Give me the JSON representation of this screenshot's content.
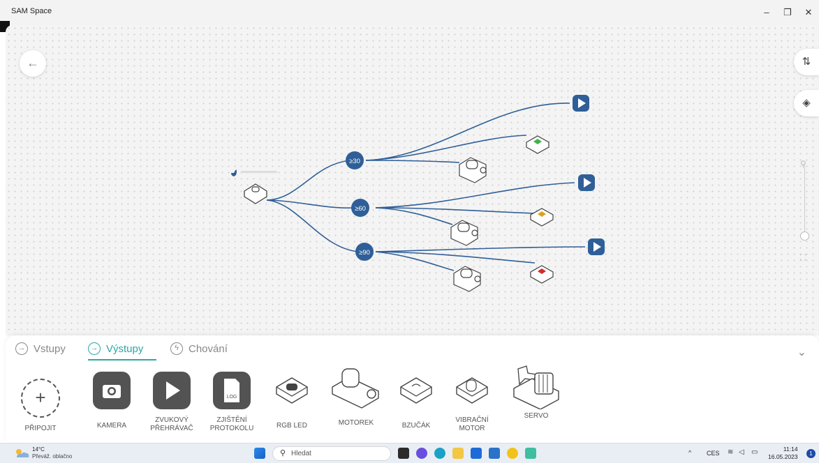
{
  "app": {
    "title": "SAM Space"
  },
  "window_controls": {
    "minimize": "–",
    "restore": "❐",
    "close": "✕"
  },
  "canvas": {
    "back_icon": "←",
    "conditions": [
      "≥30",
      "≥60",
      "≥90"
    ]
  },
  "tabs": [
    {
      "label": "Vstupy",
      "icon": "arrow-in-icon"
    },
    {
      "label": "Výstupy",
      "icon": "arrow-out-icon",
      "active": true
    },
    {
      "label": "Chování",
      "icon": "bolt-icon"
    }
  ],
  "tools": [
    {
      "label": "PŘIPOJIT"
    },
    {
      "label": "KAMERA"
    },
    {
      "label": "ZVUKOVÝ",
      "label2": "PŘEHRÁVAČ"
    },
    {
      "label": "ZJIŠTĚNÍ",
      "label2": "PROTOKOLU",
      "badge": "LOG"
    },
    {
      "label": "RGB LED"
    },
    {
      "label": "MOTOREK"
    },
    {
      "label": "BZUČÁK"
    },
    {
      "label": "VIBRAČNÍ",
      "label2": "MOTOR"
    },
    {
      "label": "SERVO"
    }
  ],
  "taskbar": {
    "temp": "14°C",
    "weather": "Převáž. oblačno",
    "search_placeholder": "Hledat",
    "lang": "CES",
    "time": "11:14",
    "date": "16.05.2023",
    "notifications": "1"
  },
  "colors": {
    "accent": "#2aa7a6",
    "node": "#2f5f98",
    "led_green": "#3fb549",
    "led_yellow": "#e0a21a",
    "led_red": "#d62b2b"
  }
}
